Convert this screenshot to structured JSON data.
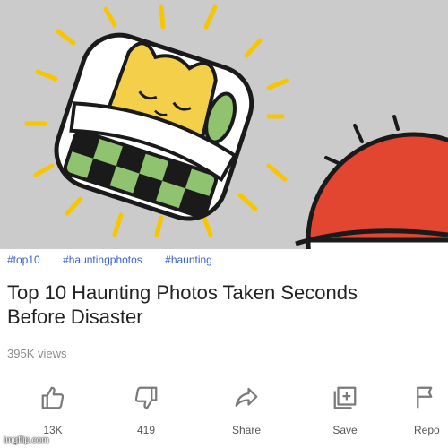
{
  "video": {
    "hashtags": [
      "#top10",
      "#hauntingphotos",
      "#haunting"
    ],
    "title_line1": "Top 10 Haunting Photos Taken Seconds",
    "title_line2": "Before Disaster",
    "views": "395K views"
  },
  "actions": {
    "like": {
      "icon": "thumbs-up-icon",
      "label": "13K"
    },
    "dislike": {
      "icon": "thumbs-down-icon",
      "label": "419"
    },
    "share": {
      "icon": "share-arrow-icon",
      "label": "Share"
    },
    "save": {
      "icon": "add-to-playlist-icon",
      "label": "Save"
    },
    "report": {
      "icon": "flag-icon",
      "label": "Repo"
    }
  },
  "watermark": "imgflip.com",
  "colors": {
    "thumbnail_bg": "#cbcbcb",
    "ray_yellow": "#f7c600",
    "blanket_green": "#8fc36f",
    "ball_red": "#e24530",
    "hashtag_blue": "#3a62c8"
  }
}
